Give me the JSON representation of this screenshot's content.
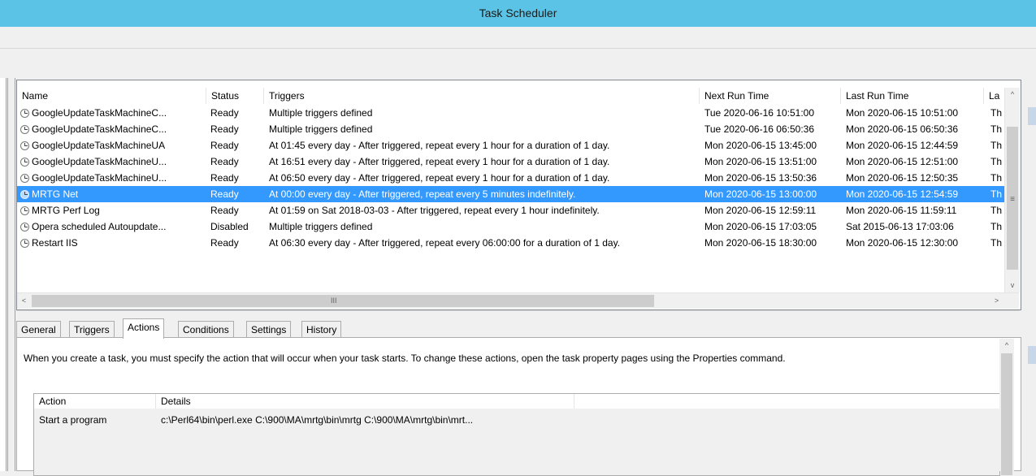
{
  "window": {
    "title": "Task Scheduler"
  },
  "task_list": {
    "columns": [
      "Name",
      "Status",
      "Triggers",
      "Next Run Time",
      "Last Run Time",
      "La"
    ],
    "rows": [
      {
        "name": "GoogleUpdateTaskMachineC...",
        "status": "Ready",
        "triggers": "Multiple triggers defined",
        "next_run": "Tue 2020-06-16 10:51:00",
        "last_run": "Mon 2020-06-15 10:51:00",
        "la": "Th",
        "selected": false
      },
      {
        "name": "GoogleUpdateTaskMachineC...",
        "status": "Ready",
        "triggers": "Multiple triggers defined",
        "next_run": "Tue 2020-06-16 06:50:36",
        "last_run": "Mon 2020-06-15 06:50:36",
        "la": "Th",
        "selected": false
      },
      {
        "name": "GoogleUpdateTaskMachineUA",
        "status": "Ready",
        "triggers": "At 01:45 every day - After triggered, repeat every 1 hour for a duration of 1 day.",
        "next_run": "Mon 2020-06-15 13:45:00",
        "last_run": "Mon 2020-06-15 12:44:59",
        "la": "Th",
        "selected": false
      },
      {
        "name": "GoogleUpdateTaskMachineU...",
        "status": "Ready",
        "triggers": "At 16:51 every day - After triggered, repeat every 1 hour for a duration of 1 day.",
        "next_run": "Mon 2020-06-15 13:51:00",
        "last_run": "Mon 2020-06-15 12:51:00",
        "la": "Th",
        "selected": false
      },
      {
        "name": "GoogleUpdateTaskMachineU...",
        "status": "Ready",
        "triggers": "At 06:50 every day - After triggered, repeat every 1 hour for a duration of 1 day.",
        "next_run": "Mon 2020-06-15 13:50:36",
        "last_run": "Mon 2020-06-15 12:50:35",
        "la": "Th",
        "selected": false
      },
      {
        "name": "MRTG Net",
        "status": "Ready",
        "triggers": "At 00:00 every day - After triggered, repeat every 5 minutes indefinitely.",
        "next_run": "Mon 2020-06-15 13:00:00",
        "last_run": "Mon 2020-06-15 12:54:59",
        "la": "Th",
        "selected": true
      },
      {
        "name": "MRTG Perf Log",
        "status": "Ready",
        "triggers": "At 01:59 on Sat 2018-03-03 - After triggered, repeat every 1 hour indefinitely.",
        "next_run": "Mon 2020-06-15 12:59:11",
        "last_run": "Mon 2020-06-15 11:59:11",
        "la": "Th",
        "selected": false
      },
      {
        "name": "Opera scheduled Autoupdate...",
        "status": "Disabled",
        "triggers": "Multiple triggers defined",
        "next_run": "Mon 2020-06-15 17:03:05",
        "last_run": "Sat 2015-06-13 17:03:06",
        "la": "Th",
        "selected": false
      },
      {
        "name": "Restart IIS",
        "status": "Ready",
        "triggers": "At 06:30 every day - After triggered, repeat every 06:00:00 for a duration of 1 day.",
        "next_run": "Mon 2020-06-15 18:30:00",
        "last_run": "Mon 2020-06-15 12:30:00",
        "la": "Th",
        "selected": false
      }
    ],
    "scroll": {
      "up": "^",
      "down": "v",
      "left": "<",
      "right": ">",
      "vgrip": "≡",
      "hgrip": "III"
    }
  },
  "details": {
    "tabs": [
      "General",
      "Triggers",
      "Actions",
      "Conditions",
      "Settings",
      "History"
    ],
    "active_tab": "Actions",
    "description": "When you create a task, you must specify the action that will occur when your task starts.  To change these actions, open the task property pages using the Properties command.",
    "actions_table": {
      "columns": [
        "Action",
        "Details"
      ],
      "rows": [
        {
          "action": "Start a program",
          "details": "c:\\Perl64\\bin\\perl.exe C:\\900\\MA\\mrtg\\bin\\mrtg C:\\900\\MA\\mrtg\\bin\\mrt..."
        }
      ]
    }
  }
}
